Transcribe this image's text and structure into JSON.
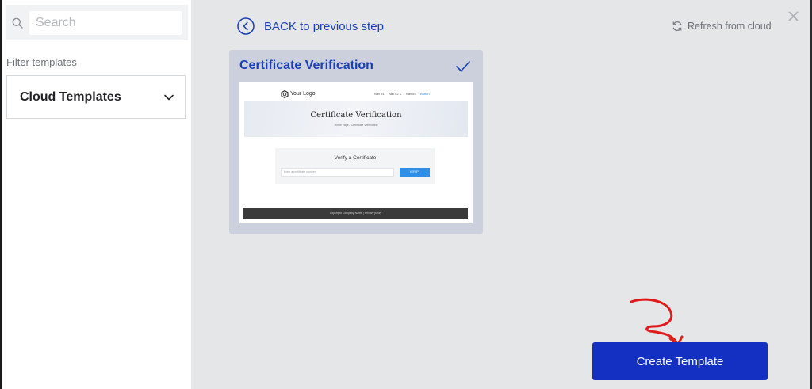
{
  "sidebar": {
    "search": {
      "placeholder": "Search",
      "value": ""
    },
    "filter_label": "Filter templates",
    "filter_select": {
      "selected": "Cloud Templates"
    }
  },
  "toolbar": {
    "back_label": "BACK to previous step",
    "refresh_label": "Refresh from cloud"
  },
  "template_card": {
    "title": "Certificate Verification",
    "selected": true,
    "preview": {
      "logo_text": "Your Logo",
      "nav": [
        "Nav #1",
        "Nav #2 ⌄",
        "Nav #3",
        "Button"
      ],
      "hero_title": "Certificate Verification",
      "breadcrumb": "Home page  /  Certificate Verification",
      "form_title": "Verify a Certificate",
      "field_placeholder": "Enter a certificate number",
      "button_label": "VERIFY",
      "footer_text": "Copyright Company Name  |  Privacy policy"
    }
  },
  "actions": {
    "create_label": "Create Template"
  },
  "colors": {
    "accent": "#1a3fb4",
    "primary_button": "#1330c2",
    "card_bg": "#ccd0dc",
    "annotation_arrow": "#e01b1b"
  },
  "icons": {
    "search": "search-icon",
    "chevron": "chevron-down-icon",
    "back": "chevron-left-circle-icon",
    "refresh": "refresh-icon",
    "close": "close-icon",
    "check": "check-icon",
    "arrow": "arrow-annotation-icon"
  }
}
